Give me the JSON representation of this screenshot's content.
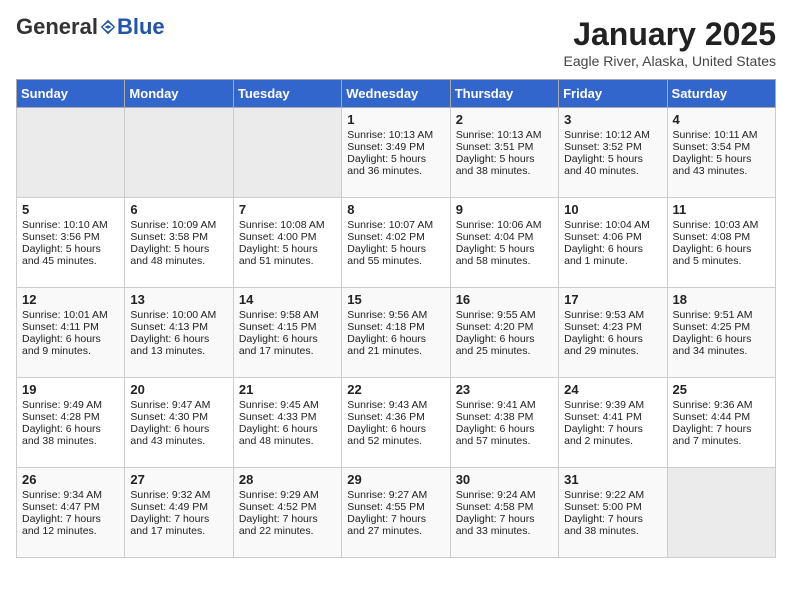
{
  "header": {
    "logo_general": "General",
    "logo_blue": "Blue",
    "title": "January 2025",
    "subtitle": "Eagle River, Alaska, United States"
  },
  "calendar": {
    "days_of_week": [
      "Sunday",
      "Monday",
      "Tuesday",
      "Wednesday",
      "Thursday",
      "Friday",
      "Saturday"
    ],
    "weeks": [
      [
        {
          "day": "",
          "empty": true
        },
        {
          "day": "",
          "empty": true
        },
        {
          "day": "",
          "empty": true
        },
        {
          "day": "1",
          "sunrise": "Sunrise: 10:13 AM",
          "sunset": "Sunset: 3:49 PM",
          "daylight": "Daylight: 5 hours and 36 minutes."
        },
        {
          "day": "2",
          "sunrise": "Sunrise: 10:13 AM",
          "sunset": "Sunset: 3:51 PM",
          "daylight": "Daylight: 5 hours and 38 minutes."
        },
        {
          "day": "3",
          "sunrise": "Sunrise: 10:12 AM",
          "sunset": "Sunset: 3:52 PM",
          "daylight": "Daylight: 5 hours and 40 minutes."
        },
        {
          "day": "4",
          "sunrise": "Sunrise: 10:11 AM",
          "sunset": "Sunset: 3:54 PM",
          "daylight": "Daylight: 5 hours and 43 minutes."
        }
      ],
      [
        {
          "day": "5",
          "sunrise": "Sunrise: 10:10 AM",
          "sunset": "Sunset: 3:56 PM",
          "daylight": "Daylight: 5 hours and 45 minutes."
        },
        {
          "day": "6",
          "sunrise": "Sunrise: 10:09 AM",
          "sunset": "Sunset: 3:58 PM",
          "daylight": "Daylight: 5 hours and 48 minutes."
        },
        {
          "day": "7",
          "sunrise": "Sunrise: 10:08 AM",
          "sunset": "Sunset: 4:00 PM",
          "daylight": "Daylight: 5 hours and 51 minutes."
        },
        {
          "day": "8",
          "sunrise": "Sunrise: 10:07 AM",
          "sunset": "Sunset: 4:02 PM",
          "daylight": "Daylight: 5 hours and 55 minutes."
        },
        {
          "day": "9",
          "sunrise": "Sunrise: 10:06 AM",
          "sunset": "Sunset: 4:04 PM",
          "daylight": "Daylight: 5 hours and 58 minutes."
        },
        {
          "day": "10",
          "sunrise": "Sunrise: 10:04 AM",
          "sunset": "Sunset: 4:06 PM",
          "daylight": "Daylight: 6 hours and 1 minute."
        },
        {
          "day": "11",
          "sunrise": "Sunrise: 10:03 AM",
          "sunset": "Sunset: 4:08 PM",
          "daylight": "Daylight: 6 hours and 5 minutes."
        }
      ],
      [
        {
          "day": "12",
          "sunrise": "Sunrise: 10:01 AM",
          "sunset": "Sunset: 4:11 PM",
          "daylight": "Daylight: 6 hours and 9 minutes."
        },
        {
          "day": "13",
          "sunrise": "Sunrise: 10:00 AM",
          "sunset": "Sunset: 4:13 PM",
          "daylight": "Daylight: 6 hours and 13 minutes."
        },
        {
          "day": "14",
          "sunrise": "Sunrise: 9:58 AM",
          "sunset": "Sunset: 4:15 PM",
          "daylight": "Daylight: 6 hours and 17 minutes."
        },
        {
          "day": "15",
          "sunrise": "Sunrise: 9:56 AM",
          "sunset": "Sunset: 4:18 PM",
          "daylight": "Daylight: 6 hours and 21 minutes."
        },
        {
          "day": "16",
          "sunrise": "Sunrise: 9:55 AM",
          "sunset": "Sunset: 4:20 PM",
          "daylight": "Daylight: 6 hours and 25 minutes."
        },
        {
          "day": "17",
          "sunrise": "Sunrise: 9:53 AM",
          "sunset": "Sunset: 4:23 PM",
          "daylight": "Daylight: 6 hours and 29 minutes."
        },
        {
          "day": "18",
          "sunrise": "Sunrise: 9:51 AM",
          "sunset": "Sunset: 4:25 PM",
          "daylight": "Daylight: 6 hours and 34 minutes."
        }
      ],
      [
        {
          "day": "19",
          "sunrise": "Sunrise: 9:49 AM",
          "sunset": "Sunset: 4:28 PM",
          "daylight": "Daylight: 6 hours and 38 minutes."
        },
        {
          "day": "20",
          "sunrise": "Sunrise: 9:47 AM",
          "sunset": "Sunset: 4:30 PM",
          "daylight": "Daylight: 6 hours and 43 minutes."
        },
        {
          "day": "21",
          "sunrise": "Sunrise: 9:45 AM",
          "sunset": "Sunset: 4:33 PM",
          "daylight": "Daylight: 6 hours and 48 minutes."
        },
        {
          "day": "22",
          "sunrise": "Sunrise: 9:43 AM",
          "sunset": "Sunset: 4:36 PM",
          "daylight": "Daylight: 6 hours and 52 minutes."
        },
        {
          "day": "23",
          "sunrise": "Sunrise: 9:41 AM",
          "sunset": "Sunset: 4:38 PM",
          "daylight": "Daylight: 6 hours and 57 minutes."
        },
        {
          "day": "24",
          "sunrise": "Sunrise: 9:39 AM",
          "sunset": "Sunset: 4:41 PM",
          "daylight": "Daylight: 7 hours and 2 minutes."
        },
        {
          "day": "25",
          "sunrise": "Sunrise: 9:36 AM",
          "sunset": "Sunset: 4:44 PM",
          "daylight": "Daylight: 7 hours and 7 minutes."
        }
      ],
      [
        {
          "day": "26",
          "sunrise": "Sunrise: 9:34 AM",
          "sunset": "Sunset: 4:47 PM",
          "daylight": "Daylight: 7 hours and 12 minutes."
        },
        {
          "day": "27",
          "sunrise": "Sunrise: 9:32 AM",
          "sunset": "Sunset: 4:49 PM",
          "daylight": "Daylight: 7 hours and 17 minutes."
        },
        {
          "day": "28",
          "sunrise": "Sunrise: 9:29 AM",
          "sunset": "Sunset: 4:52 PM",
          "daylight": "Daylight: 7 hours and 22 minutes."
        },
        {
          "day": "29",
          "sunrise": "Sunrise: 9:27 AM",
          "sunset": "Sunset: 4:55 PM",
          "daylight": "Daylight: 7 hours and 27 minutes."
        },
        {
          "day": "30",
          "sunrise": "Sunrise: 9:24 AM",
          "sunset": "Sunset: 4:58 PM",
          "daylight": "Daylight: 7 hours and 33 minutes."
        },
        {
          "day": "31",
          "sunrise": "Sunrise: 9:22 AM",
          "sunset": "Sunset: 5:00 PM",
          "daylight": "Daylight: 7 hours and 38 minutes."
        },
        {
          "day": "",
          "empty": true
        }
      ]
    ]
  }
}
